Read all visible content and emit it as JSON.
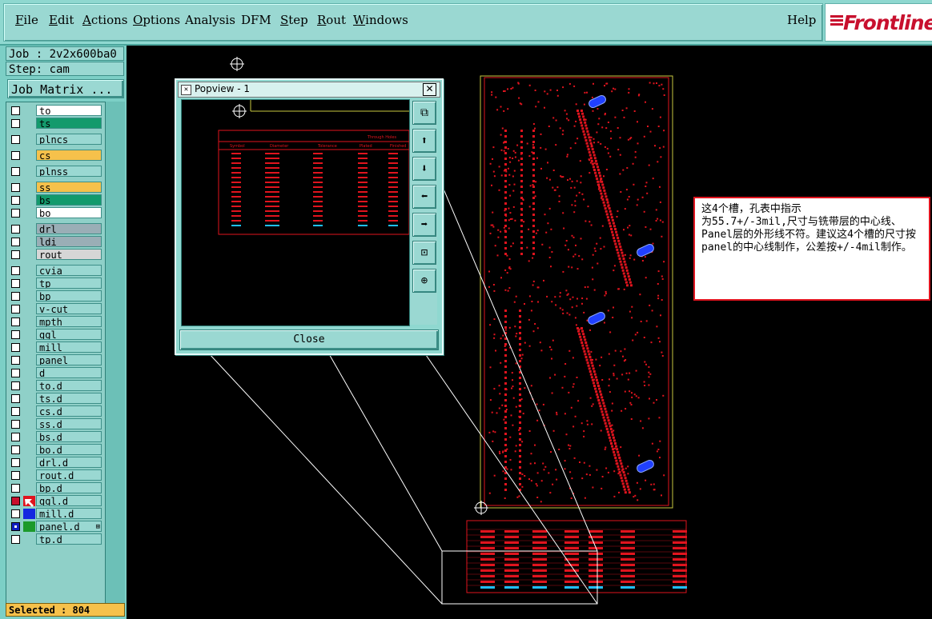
{
  "menu": {
    "items": [
      {
        "label": "File",
        "underline": "F",
        "rest": "ile"
      },
      {
        "label": "Edit",
        "underline": "E",
        "rest": "dit"
      },
      {
        "label": "Actions",
        "underline": "A",
        "rest": "ctions"
      },
      {
        "label": "Options",
        "underline": "O",
        "rest": "ptions"
      },
      {
        "label": "Analysis",
        "underline": "",
        "rest": "Analysis"
      },
      {
        "label": "DFM",
        "underline": "",
        "rest": "DFM"
      },
      {
        "label": "Step",
        "underline": "S",
        "rest": "tep"
      },
      {
        "label": "Rout",
        "underline": "R",
        "rest": "out"
      },
      {
        "label": "Windows",
        "underline": "W",
        "rest": "indows"
      }
    ],
    "help": "Help",
    "logo": "Frontline"
  },
  "job": {
    "line": "Job : 2v2x600ba0",
    "step": "Step: cam",
    "matrix_button": "Job Matrix ..."
  },
  "layers": [
    {
      "name": "to",
      "bg": "#ffffff",
      "group": 0
    },
    {
      "name": "ts",
      "bg": "#139a6c",
      "group": 0
    },
    {
      "name": "plncs",
      "bg": "#9ad8d2",
      "group": 1
    },
    {
      "name": "cs",
      "bg": "#f6c14b",
      "group": 2
    },
    {
      "name": "plnss",
      "bg": "#9ad8d2",
      "group": 3
    },
    {
      "name": "ss",
      "bg": "#f6c14b",
      "group": 4
    },
    {
      "name": "bs",
      "bg": "#139a6c",
      "group": 4
    },
    {
      "name": "bo",
      "bg": "#ffffff",
      "group": 4
    },
    {
      "name": "drl",
      "bg": "#9aaeb6",
      "group": 5
    },
    {
      "name": "ldi",
      "bg": "#9aaeb6",
      "group": 5
    },
    {
      "name": "rout",
      "bg": "#d6d6d6",
      "group": 5
    },
    {
      "name": "cvia",
      "bg": "#9ad8d2",
      "group": 6
    },
    {
      "name": "tp",
      "bg": "#9ad8d2",
      "group": 6
    },
    {
      "name": "bp",
      "bg": "#9ad8d2",
      "group": 6
    },
    {
      "name": "v-cut",
      "bg": "#9ad8d2",
      "group": 6
    },
    {
      "name": "mpth",
      "bg": "#9ad8d2",
      "group": 6
    },
    {
      "name": "ggl",
      "bg": "#9ad8d2",
      "group": 6
    },
    {
      "name": "mill",
      "bg": "#9ad8d2",
      "group": 6
    },
    {
      "name": "panel",
      "bg": "#9ad8d2",
      "group": 6
    },
    {
      "name": "d",
      "bg": "#9ad8d2",
      "group": 6
    },
    {
      "name": "to.d",
      "bg": "#9ad8d2",
      "group": 6
    },
    {
      "name": "ts.d",
      "bg": "#9ad8d2",
      "group": 6
    },
    {
      "name": "cs.d",
      "bg": "#9ad8d2",
      "group": 6
    },
    {
      "name": "ss.d",
      "bg": "#9ad8d2",
      "group": 6
    },
    {
      "name": "bs.d",
      "bg": "#9ad8d2",
      "group": 6
    },
    {
      "name": "bo.d",
      "bg": "#9ad8d2",
      "group": 6
    },
    {
      "name": "drl.d",
      "bg": "#9ad8d2",
      "group": 6
    },
    {
      "name": "rout.d",
      "bg": "#9ad8d2",
      "group": 6
    },
    {
      "name": "bp.d",
      "bg": "#9ad8d2",
      "group": 6
    },
    {
      "name": "ggl.d",
      "bg": "#9ad8d2",
      "group": 6,
      "checked": "red",
      "swatch": "#e0141e",
      "arrow": true
    },
    {
      "name": "mill.d",
      "bg": "#9ad8d2",
      "group": 6,
      "swatch": "#1428e0"
    },
    {
      "name": "panel.d",
      "bg": "#9ad8d2",
      "group": 6,
      "checked": "blue",
      "swatch": "#1c9a2a",
      "mark": "⊞"
    },
    {
      "name": "tp.d",
      "bg": "#9ad8d2",
      "group": 6
    }
  ],
  "selected": "Selected : 804",
  "popview": {
    "title": "Popview - 1",
    "close": "Close",
    "table_title": "Through Holes",
    "headers": [
      "Symbol",
      "Diameter",
      "Tolerance",
      "Plated",
      "Finished"
    ]
  },
  "note": {
    "text": "这4个槽，孔表中指示\n为55.7+/-3mil,尺寸与铣带层的中心线、Panel层的外形线不符。建议这4个槽的尺寸按panel的中心线制作，公差按+/-4mil制作。"
  },
  "colors": {
    "accent": "#8fd8d0",
    "drawing": "#e0141e",
    "highlight": "#2040ff",
    "board_outline": "#c8c840"
  }
}
